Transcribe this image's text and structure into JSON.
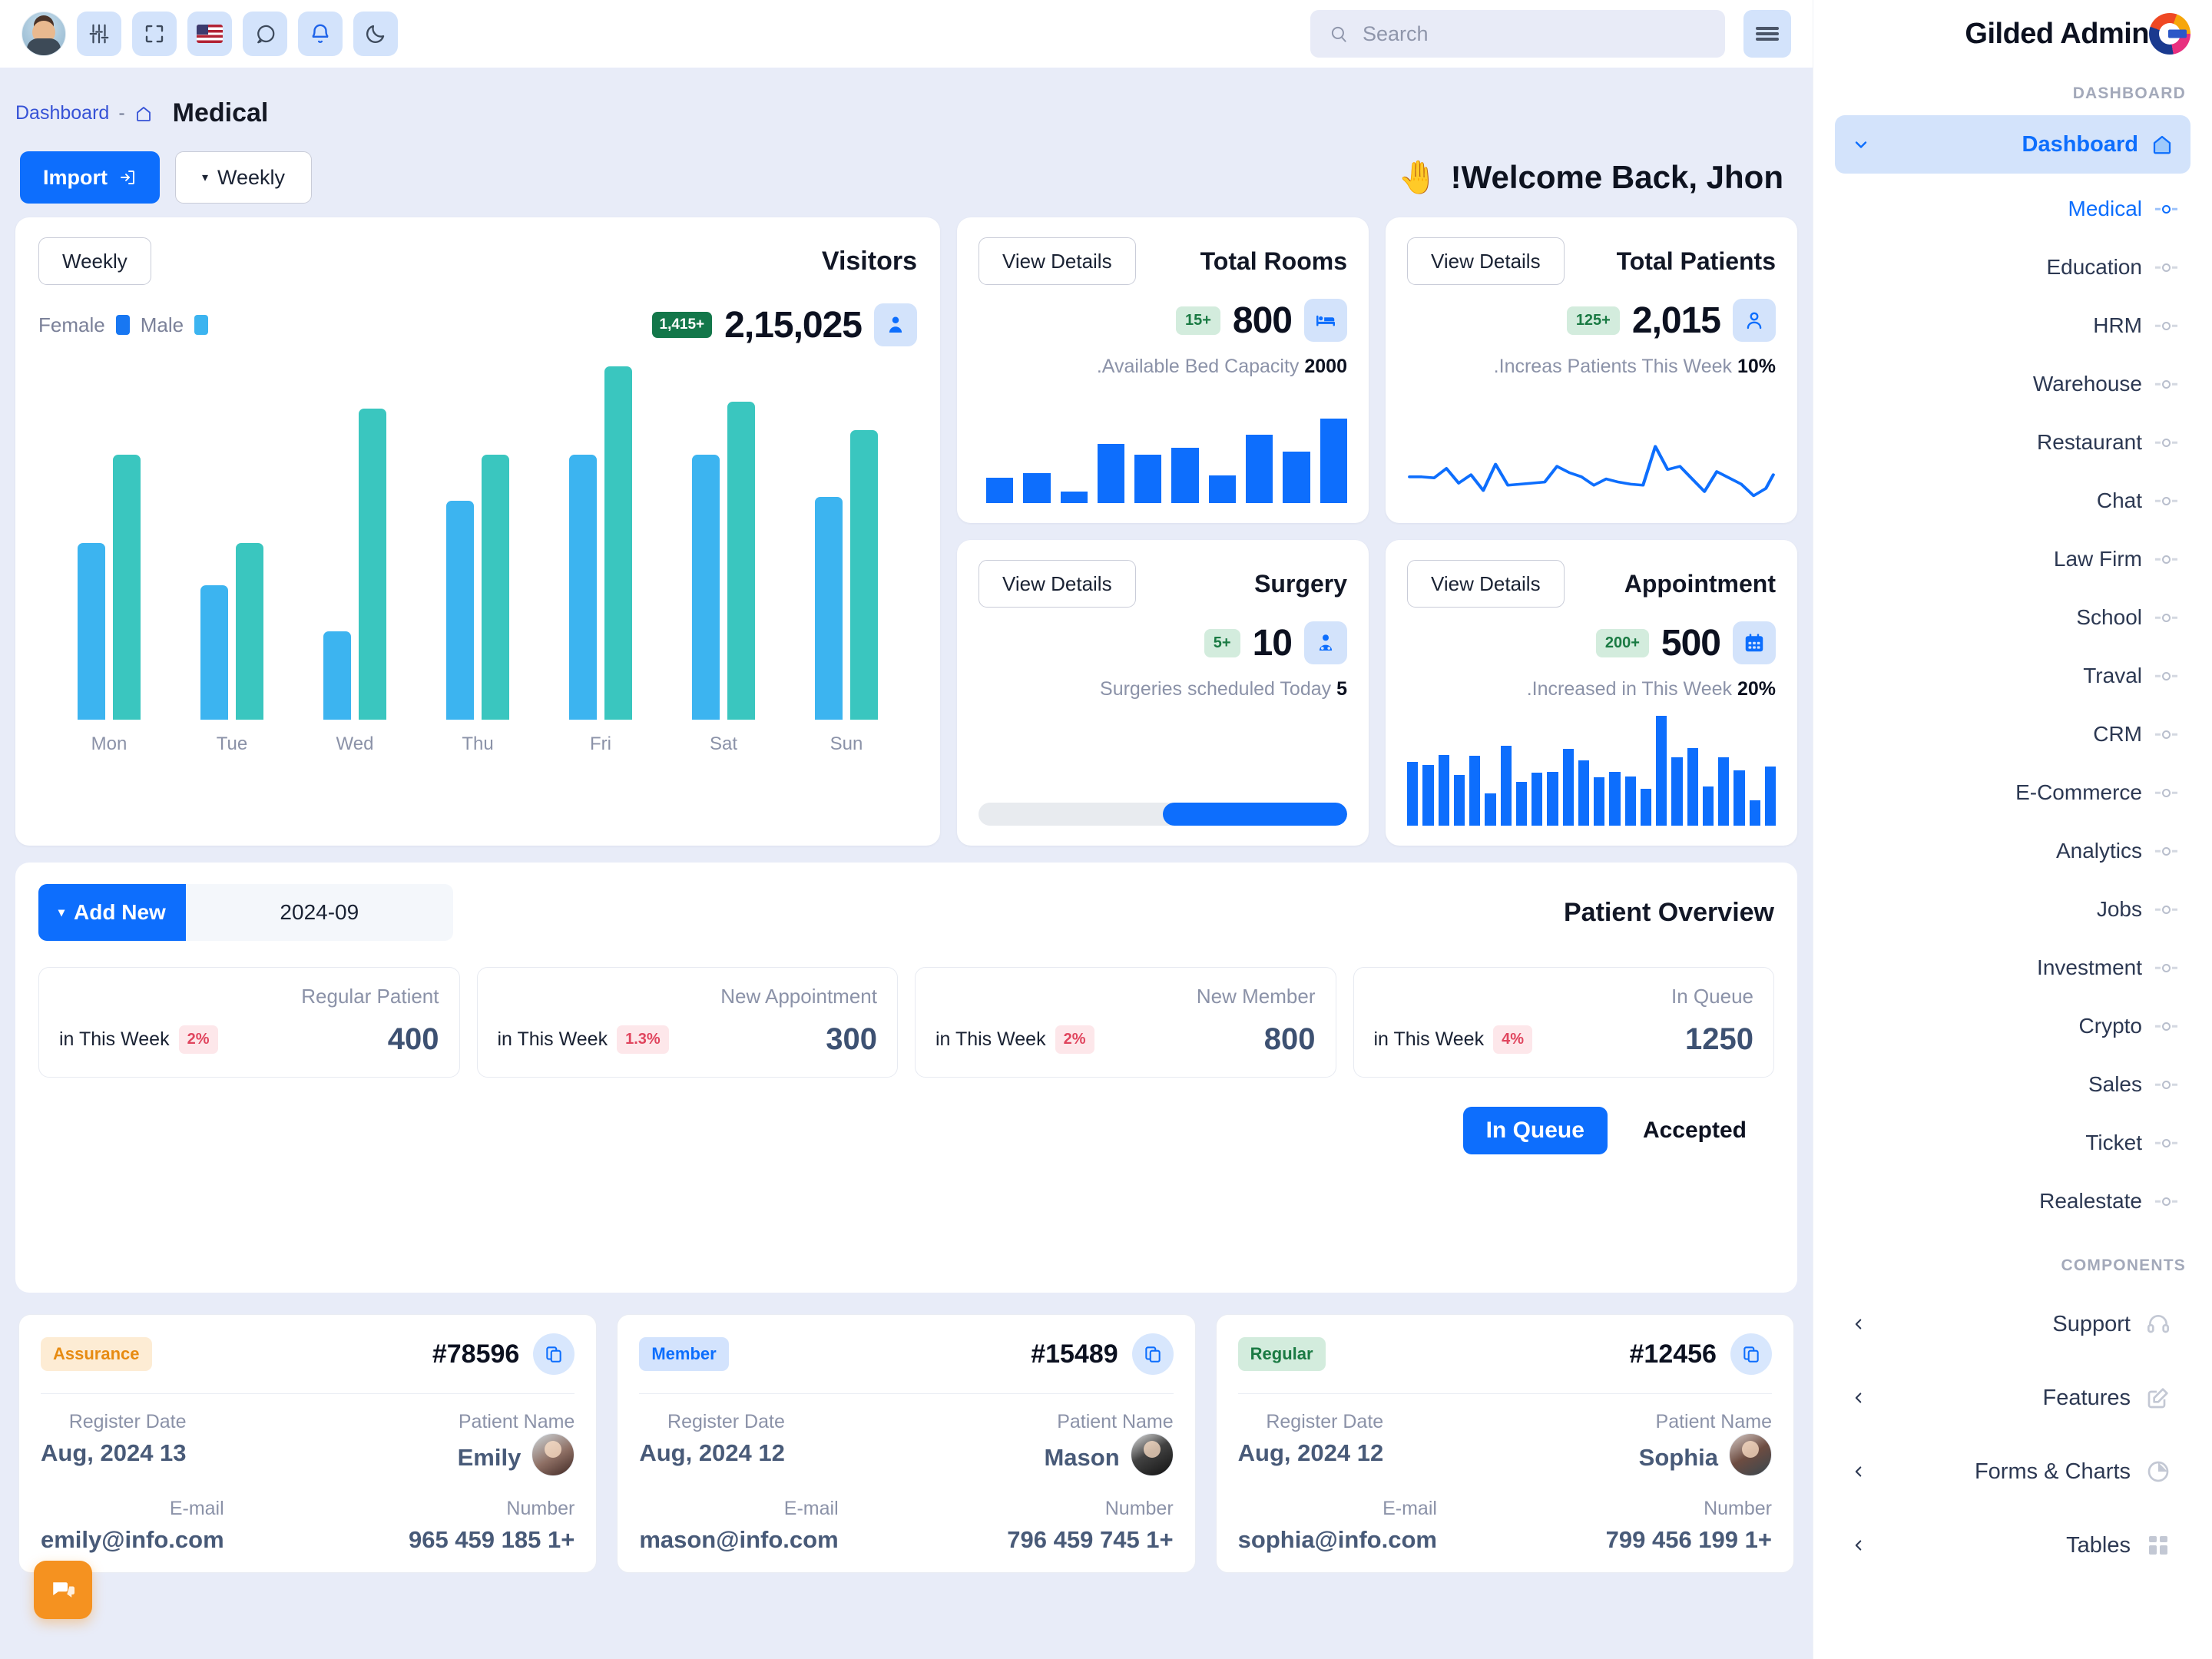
{
  "topbar": {
    "icons": [
      "sliders-icon",
      "fullscreen-icon",
      "flag-usa-icon",
      "chat-icon",
      "bell-icon",
      "moon-icon"
    ],
    "search_placeholder": "Search",
    "menu_label": "hamburger-menu"
  },
  "brand": {
    "name": "Gilded Admin"
  },
  "breadcrumb": {
    "page": "Medical",
    "parent": "Dashboard",
    "separator": "-"
  },
  "welcome": {
    "import_label": "Import",
    "period_label": "Weekly",
    "title": "!Welcome Back, Jhon",
    "wave": "🤚"
  },
  "visitors": {
    "period_label": "Weekly",
    "title": "Visitors",
    "legend": [
      "Female",
      "Male"
    ],
    "badge": "1,415+",
    "total": "2,15,025",
    "colors": {
      "female": "#3cb4f0",
      "male": "#3ac6bf",
      "badge_bg": "#13774a"
    }
  },
  "cards": [
    {
      "title": "Total Rooms",
      "action": "View Details",
      "badge": "15+",
      "value": "800",
      "foot_text": ".Available Bed Capacity",
      "foot_value": "2000",
      "icon": "bed-icon"
    },
    {
      "title": "Total Patients",
      "action": "View Details",
      "badge": "125+",
      "value": "2,015",
      "foot_text": ".Increas Patients This Week",
      "foot_value": "10%",
      "icon": "user-icon"
    },
    {
      "title": "Surgery",
      "action": "View Details",
      "badge": "5+",
      "value": "10",
      "foot_text": "Surgeries scheduled Today",
      "foot_value": "5",
      "icon": "doctor-icon"
    },
    {
      "title": "Appointment",
      "action": "View Details",
      "badge": "200+",
      "value": "500",
      "foot_text": ".Increased in This Week",
      "foot_value": "20%",
      "icon": "calendar-icon"
    }
  ],
  "overview": {
    "add_new_label": "Add New",
    "date_value": "2024-09",
    "title": "Patient Overview",
    "stats": [
      {
        "label": "Regular Patient",
        "week_text": "in This Week",
        "delta": "2%",
        "value": "400"
      },
      {
        "label": "New Appointment",
        "week_text": "in This Week",
        "delta": "1.3%",
        "value": "300"
      },
      {
        "label": "New Member",
        "week_text": "in This Week",
        "delta": "2%",
        "value": "800"
      },
      {
        "label": "In Queue",
        "week_text": "in This Week",
        "delta": "4%",
        "value": "1250"
      }
    ],
    "tabs": [
      {
        "label": "In Queue",
        "active": true
      },
      {
        "label": "Accepted",
        "active": false
      }
    ],
    "field_labels": {
      "register_date": "Register Date",
      "patient_name": "Patient Name",
      "email": "E-mail",
      "number": "Number"
    },
    "patients": [
      {
        "tag": "Assurance",
        "id": "#78596",
        "register_date": "Aug, 2024 13",
        "name": "Emily",
        "email": "emily@info.com",
        "number": "965 459 185 1+"
      },
      {
        "tag": "Member",
        "id": "#15489",
        "register_date": "Aug, 2024 12",
        "name": "Mason",
        "email": "mason@info.com",
        "number": "796 459 745 1+"
      },
      {
        "tag": "Regular",
        "id": "#12456",
        "register_date": "Aug, 2024 12",
        "name": "Sophia",
        "email": "sophia@info.com",
        "number": "799 456 199 1+"
      }
    ]
  },
  "sidebar": {
    "group_dashboard": "DASHBOARD",
    "group_components": "COMPONENTS",
    "dashboard_label": "Dashboard",
    "items": [
      {
        "label": "Medical",
        "selected": true
      },
      {
        "label": "Education",
        "selected": false
      },
      {
        "label": "HRM",
        "selected": false
      },
      {
        "label": "Warehouse",
        "selected": false
      },
      {
        "label": "Restaurant",
        "selected": false
      },
      {
        "label": "Chat",
        "selected": false
      },
      {
        "label": "Law Firm",
        "selected": false
      },
      {
        "label": "School",
        "selected": false
      },
      {
        "label": "Traval",
        "selected": false
      },
      {
        "label": "CRM",
        "selected": false
      },
      {
        "label": "E-Commerce",
        "selected": false
      },
      {
        "label": "Analytics",
        "selected": false
      },
      {
        "label": "Jobs",
        "selected": false
      },
      {
        "label": "Investment",
        "selected": false
      },
      {
        "label": "Crypto",
        "selected": false
      },
      {
        "label": "Sales",
        "selected": false
      },
      {
        "label": "Ticket",
        "selected": false
      },
      {
        "label": "Realestate",
        "selected": false
      }
    ],
    "components": [
      {
        "label": "Support",
        "icon": "headset-icon"
      },
      {
        "label": "Features",
        "icon": "edit-square-icon"
      },
      {
        "label": "Forms & Charts",
        "icon": "pie-chart-icon"
      },
      {
        "label": "Tables",
        "icon": "grid-icon"
      }
    ]
  },
  "chart_data": [
    {
      "type": "bar",
      "title": "Visitors",
      "categories": [
        "Mon",
        "Tue",
        "Wed",
        "Thu",
        "Fri",
        "Sat",
        "Sun"
      ],
      "series": [
        {
          "name": "Female",
          "color": "#3cb4f0",
          "values": [
            50,
            38,
            25,
            62,
            75,
            75,
            63
          ]
        },
        {
          "name": "Male",
          "color": "#3ac6bf",
          "values": [
            75,
            50,
            88,
            75,
            100,
            90,
            82
          ]
        }
      ],
      "ylim": [
        0,
        100
      ],
      "grid": false,
      "legend": "top-left",
      "xlabel": "",
      "ylabel": ""
    },
    {
      "type": "bar",
      "title": "Total Rooms",
      "values": [
        22,
        26,
        10,
        52,
        42,
        48,
        24,
        60,
        45,
        74
      ],
      "ylim": [
        0,
        100
      ],
      "grid": false
    },
    {
      "type": "line",
      "title": "Total Patients",
      "values": [
        42,
        42,
        40,
        55,
        32,
        44,
        20,
        62,
        28,
        30,
        31,
        34,
        58,
        48,
        42,
        28,
        38,
        34,
        30,
        28,
        90,
        54,
        58,
        38,
        18,
        50,
        40,
        30,
        12,
        24,
        44
      ],
      "ylim": [
        0,
        100
      ],
      "grid": false
    },
    {
      "type": "bar",
      "title": "Appointment",
      "values": [
        56,
        53,
        62,
        44,
        61,
        28,
        70,
        38,
        46,
        47,
        67,
        57,
        42,
        47,
        43,
        32,
        96,
        60,
        68,
        34,
        60,
        48,
        22,
        52
      ],
      "ylim": [
        0,
        100
      ],
      "grid": false
    },
    {
      "type": "progress",
      "title": "Surgery",
      "value": 50,
      "ylim": [
        0,
        100
      ]
    }
  ]
}
